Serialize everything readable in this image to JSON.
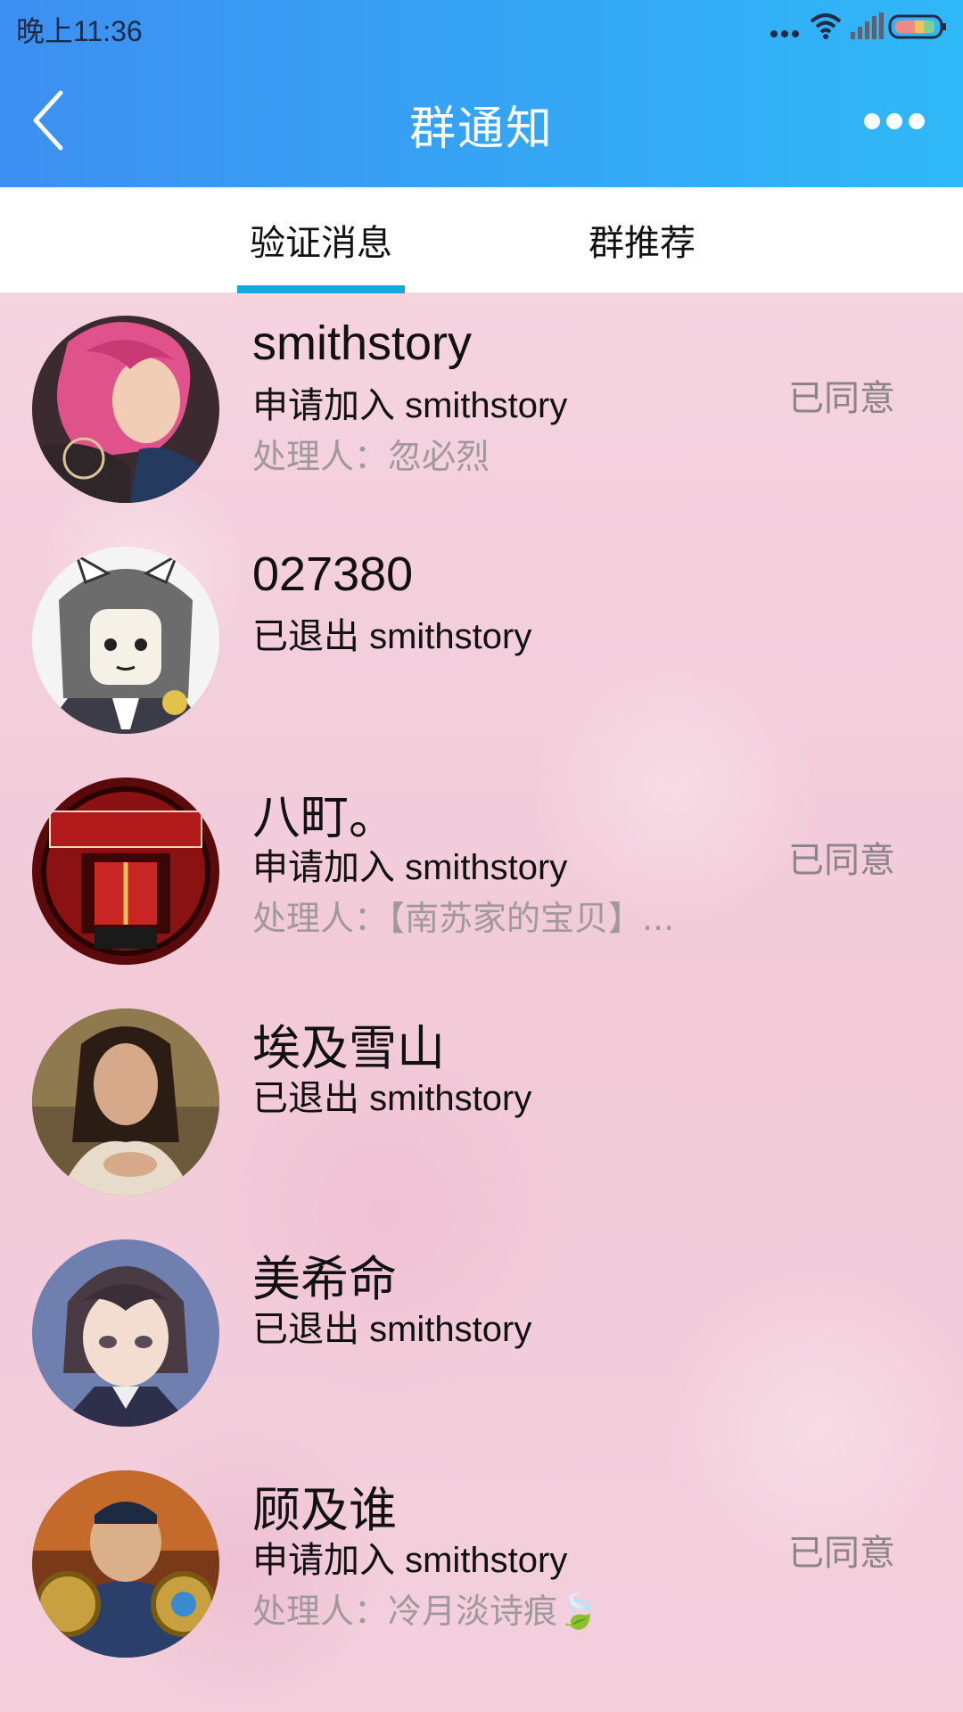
{
  "status_bar": {
    "time": "晚上11:36"
  },
  "header": {
    "title": "群通知",
    "back_icon": "chevron-left-icon",
    "more_icon": "more-dots-icon"
  },
  "tabs": [
    {
      "label": "验证消息",
      "active": true
    },
    {
      "label": "群推荐",
      "active": false
    }
  ],
  "colors": {
    "header_start": "#3d8ff1",
    "header_end": "#2fb8f7",
    "tab_underline": "#13a8e0"
  },
  "notifications": [
    {
      "name": "smithstory",
      "action": "申请加入 smithstory",
      "handler": "处理人：忽必烈",
      "status": "已同意"
    },
    {
      "name": "027380",
      "action": "已退出 smithstory",
      "handler": "",
      "status": ""
    },
    {
      "name": "八町。",
      "action": "申请加入 smithstory",
      "handler": "处理人：【南苏家的宝贝】...",
      "status": "已同意"
    },
    {
      "name": "埃及雪山",
      "action": "已退出 smithstory",
      "handler": "",
      "status": ""
    },
    {
      "name": "美希命",
      "action": "已退出 smithstory",
      "handler": "",
      "status": ""
    },
    {
      "name": "顾及谁",
      "action": "申请加入 smithstory",
      "handler": "处理人：冷月淡诗痕🍃",
      "status": "已同意"
    }
  ]
}
